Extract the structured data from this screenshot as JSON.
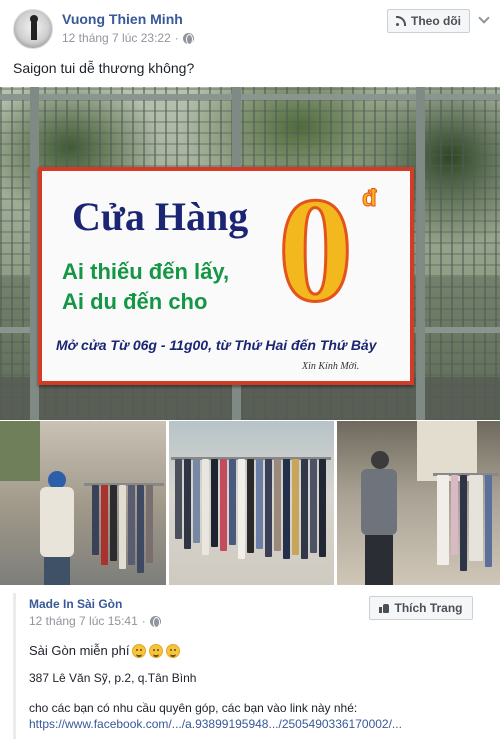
{
  "post": {
    "author": "Vuong Thien Minh",
    "timestamp": "12 tháng 7 lúc 23:22",
    "privacy_icon": "globe-icon",
    "follow_label": "Theo dõi",
    "text": "Saigon tui dễ thương không?"
  },
  "banner": {
    "title": "Cửa Hàng",
    "zero": "0",
    "currency": "đ",
    "line1": "Ai thiếu đến lấy,",
    "line2": "Ai du đến cho",
    "hours": "Mở cửa Từ 06g - 11g00, từ Thứ Hai đến Thứ Bảy",
    "welcome": "Xin Kính Mời."
  },
  "shared": {
    "page_name": "Made In Sài Gòn",
    "timestamp": "12 tháng 7 lúc 15:41",
    "like_label": "Thích Trang",
    "text1": "Sài Gòn miễn phí",
    "text2": "387 Lê Văn Sỹ, p.2, q.Tân Bình",
    "text3": "cho các bạn có nhu cầu quyên góp, các bạn vào link này nhé:",
    "url": "https://www.facebook.com/.../a.93899195948.../2505490336170002/..."
  },
  "colors": {
    "link_blue": "#385898",
    "meta_gray": "#90949c",
    "banner_red": "#d23b25",
    "banner_green": "#149645",
    "banner_navy": "#1b2573"
  }
}
